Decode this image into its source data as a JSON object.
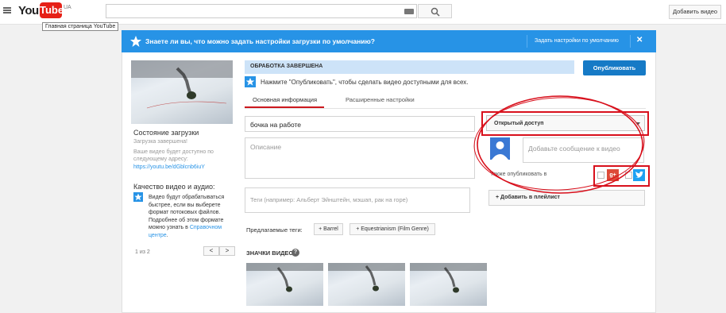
{
  "header": {
    "logo_you": "You",
    "logo_tube": "Tube",
    "logo_region": "UA",
    "home_tooltip": "Главная страница YouTube",
    "upload_label": "Добавить видео"
  },
  "banner": {
    "text": "Знаете ли вы, что можно задать настройки загрузки по умолчанию?",
    "settings_link": "Задать настройки по умолчанию",
    "close": "✕"
  },
  "left": {
    "status_title": "Состояние загрузки",
    "status_done": "Загрузка завершена!",
    "status_desc": "Ваше видео будет доступно по следующему адресу:",
    "status_link": "https://youtu.be/dGblcnb6iuY",
    "quality_title": "Качество видео и аудио:",
    "quality_desc": "Видео будут обрабатываться быстрее, если вы выберете формат потоковых файлов. Подробнее об этом формате можно узнать в",
    "quality_link": "Справочном центре",
    "quality_end": ".",
    "pager": "1 из 2",
    "pager_prev": "<",
    "pager_next": ">"
  },
  "center": {
    "processing": "ОБРАБОТКА ЗАВЕРШЕНА",
    "info": "Нажмите \"Опубликовать\", чтобы сделать видео доступными для всех.",
    "tab_basic": "Основная информация",
    "tab_advanced": "Расширенные настройки",
    "title_value": "бочка на работе",
    "desc_placeholder": "Описание",
    "tags_placeholder": "Теги (например: Альберт Эйнштейн, мэшап, рак на горе)",
    "suggested_label": "Предлагаемые теги:",
    "suggested_tags": [
      "+ Barrel",
      "+ Equestrianism (Film Genre)"
    ],
    "thumbs_title": "ЗНАЧКИ ВИДЕО",
    "help": "?"
  },
  "right": {
    "publish_label": "Опубликовать",
    "privacy_value": "Открытый доступ",
    "message_placeholder": "Добавьте сообщение к видео",
    "also_publish": "Также опубликовать в",
    "gplus": "g+",
    "playlist": "+ Добавить в плейлист"
  },
  "colors": {
    "banner": "#2793e6",
    "publish": "#167ac6",
    "annotation": "#d8101c",
    "youtube_red": "#e62117"
  }
}
